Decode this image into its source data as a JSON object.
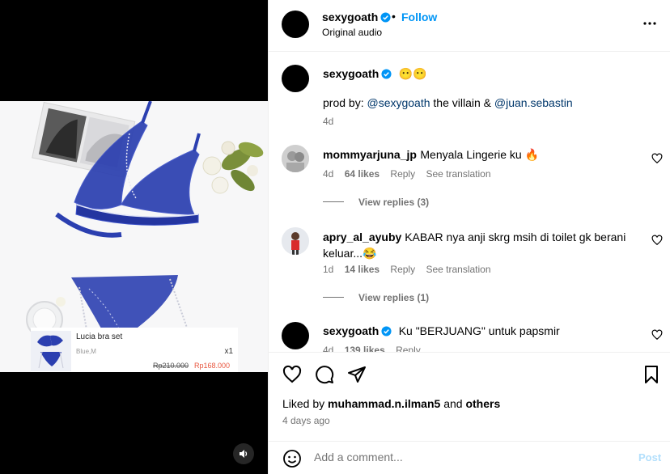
{
  "post": {
    "username": "sexygoath",
    "follow_label": "Follow",
    "dot": "•",
    "audio": "Original audio"
  },
  "product": {
    "name": "Lucia bra set",
    "variant": "Blue,M",
    "qty": "x1",
    "old_price": "Rp210.000",
    "new_price": "Rp168.000"
  },
  "caption": {
    "username": "sexygoath",
    "emojis": "😶😶",
    "prefix": "prod by: ",
    "mention1": "@sexygoath",
    "middle": " the villain & ",
    "mention2": "@juan.sebastin",
    "time": "4d"
  },
  "comments": [
    {
      "username": "mommyarjuna_jp",
      "text": "Menyala Lingerie ku 🔥",
      "time": "4d",
      "likes": "64 likes",
      "reply": "Reply",
      "translate": "See translation",
      "view_replies": "View replies (3)"
    },
    {
      "username": "apry_al_ayuby",
      "text": "KABAR nya anji skrg msih di toilet gk berani keluar...😂",
      "time": "1d",
      "likes": "14 likes",
      "reply": "Reply",
      "translate": "See translation",
      "view_replies": "View replies (1)"
    },
    {
      "username": "sexygoath",
      "text": "Ku \"BERJUANG\" untuk papsmir",
      "time": "4d",
      "likes": "139 likes",
      "reply": "Reply"
    }
  ],
  "likes": {
    "prefix": "Liked by ",
    "user": "muhammad.n.ilman5",
    "middle": " and ",
    "others": "others",
    "date": "4 days ago"
  },
  "composer": {
    "placeholder": "Add a comment...",
    "post_label": "Post"
  },
  "colors": {
    "link": "#0095f6",
    "mention": "#00376b",
    "verified": "#0095f6",
    "price_new": "#e8563e",
    "lingerie": "#2b3fb0"
  },
  "icons": [
    "verified-icon",
    "more-icon",
    "heart-icon",
    "comment-icon",
    "share-icon",
    "bookmark-icon",
    "emoji-icon",
    "audio-icon"
  ]
}
